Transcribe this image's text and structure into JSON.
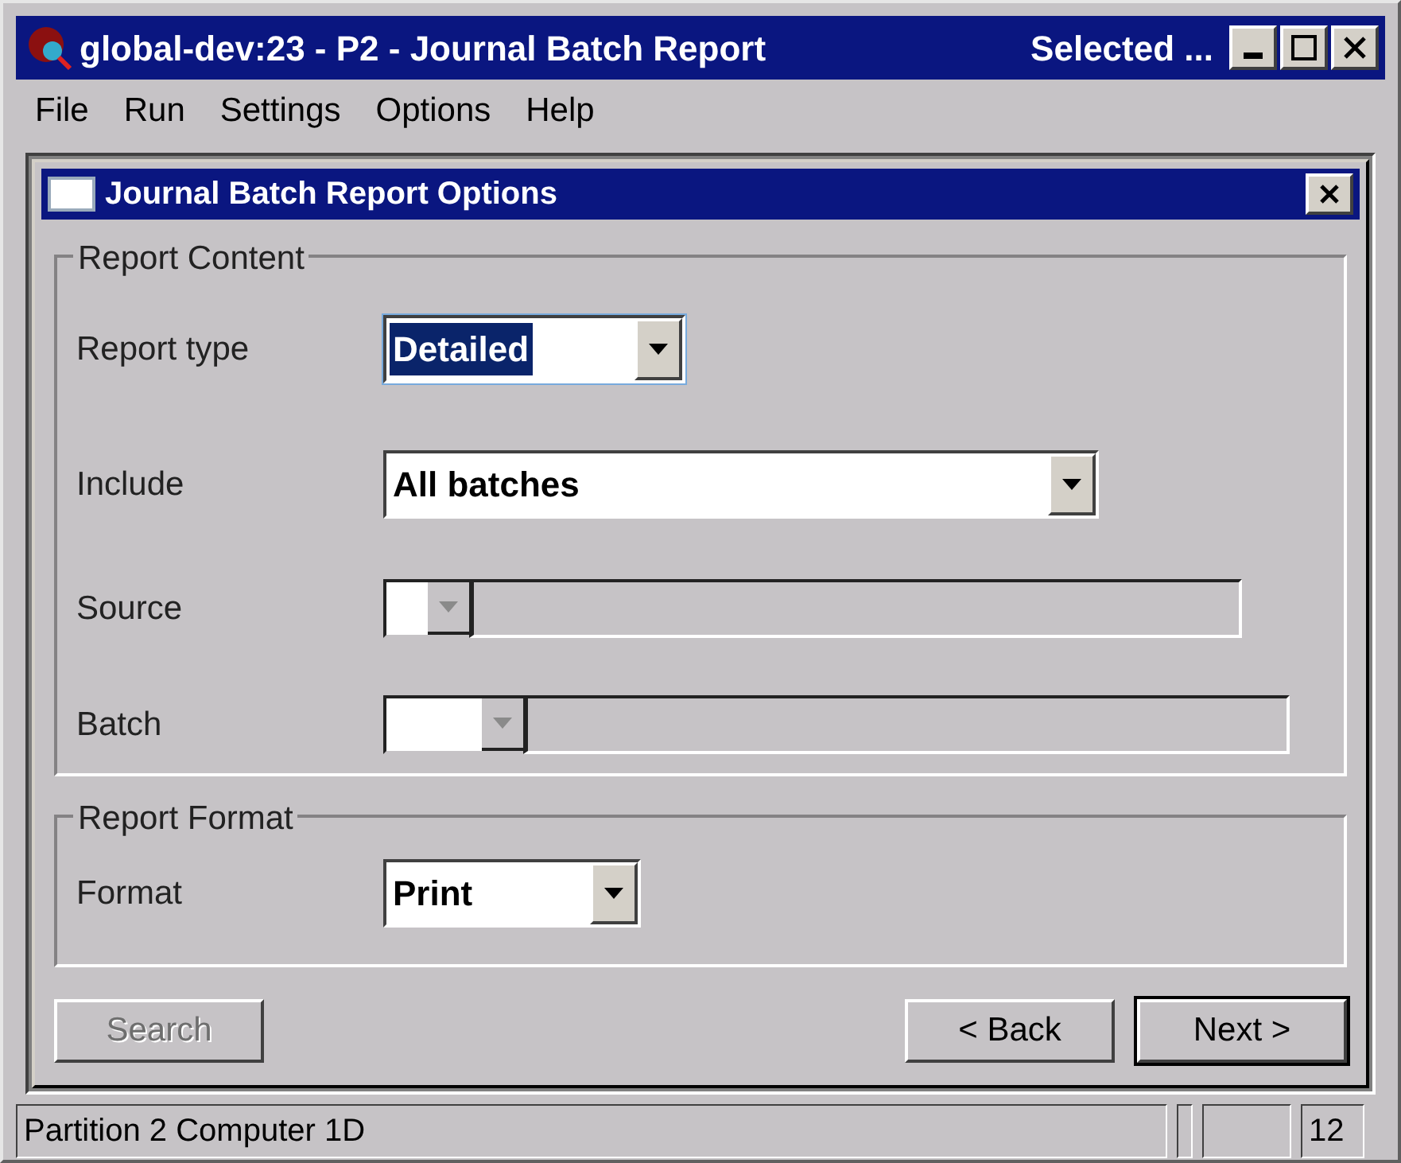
{
  "window": {
    "title": "global-dev:23 - P2 - Journal Batch Report",
    "status": "Selected ..."
  },
  "menu": [
    "File",
    "Run",
    "Settings",
    "Options",
    "Help"
  ],
  "dialog": {
    "title": "Journal Batch Report Options"
  },
  "groups": [
    {
      "title": "Report Content",
      "fields": [
        {
          "label": "Report type",
          "kind": "combo",
          "value": "Detailed",
          "selected": true,
          "disabled": false
        },
        {
          "label": "Include",
          "kind": "combo",
          "value": "All batches",
          "selected": false,
          "disabled": false
        },
        {
          "label": "Source",
          "kind": "lookup",
          "disabled": true
        },
        {
          "label": "Batch",
          "kind": "lookup",
          "disabled": true
        }
      ]
    },
    {
      "title": "Report Format",
      "fields": [
        {
          "label": "Format",
          "kind": "combo",
          "value": "Print",
          "selected": false,
          "disabled": false
        }
      ]
    }
  ],
  "buttons": [
    {
      "label": "Search",
      "disabled": true
    },
    {
      "label": "< Back",
      "disabled": false
    },
    {
      "label": "Next >",
      "disabled": false
    }
  ],
  "status_bar": [
    "Partition 2 Computer 1D",
    "12"
  ]
}
